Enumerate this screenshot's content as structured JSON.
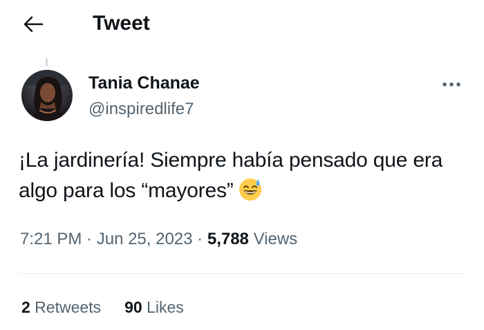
{
  "header": {
    "back_icon": "arrow-left-icon",
    "title": "Tweet"
  },
  "author": {
    "display_name": "Tania Chanae",
    "handle": "@inspiredlife7"
  },
  "more_icon": "more-dots-icon",
  "tweet": {
    "text": "¡La jardinería! Siempre había pensado que era algo para los “mayores”",
    "emoji": "sweat-smile-emoji"
  },
  "meta": {
    "time": "7:21 PM",
    "separator1": " · ",
    "date": "Jun 25, 2023",
    "separator2": " · ",
    "views_count": "5,788",
    "views_label": " Views"
  },
  "stats": {
    "retweets_count": "2",
    "retweets_label": " Retweets",
    "likes_count": "90",
    "likes_label": " Likes"
  },
  "colors": {
    "text_primary": "#0f1419",
    "text_secondary": "#536471",
    "divider": "#e7e9ea",
    "background": "#ffffff"
  }
}
